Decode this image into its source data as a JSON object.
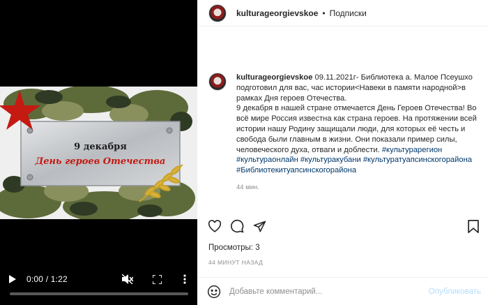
{
  "video": {
    "slide_date": "9 декабря",
    "slide_title": "День героев Отечества",
    "time": "0:00 / 1:22",
    "progress_fraction": 0.0
  },
  "post": {
    "username": "kulturageorgievskoe",
    "separator": "•",
    "follow": "Подписки"
  },
  "caption": {
    "username": "kulturageorgievskoe",
    "line1": " 09.11.2021г- Библиотека а. Малое Псеушхо подготовил для вас, час истории<Навеки в памяти народной>в рамках Дня героев Отечества.",
    "line2": "9 декабря в нашей стране отмечается День Героев Отечества! Во всё мире Россия известна как страна героев. На протяжении всей истории нашу Родину защищали люди, для которых её честь и свобода были главным в жизни. Они показали пример силы, человеческого духа, отваги и доблести. ",
    "hashtags": [
      "#культурарегион",
      "#культураонлайн",
      "#культуракубани",
      "#культуратуапсинскогорайона",
      "#Библиотекитуапсинскогорайона"
    ],
    "time": "44 мин."
  },
  "stats": {
    "views_label": "Просмотры:",
    "views_count": "3",
    "posted_ago": "44 МИНУТ НАЗАД"
  },
  "comment": {
    "placeholder": "Добавьте комментарий...",
    "publish": "Опубликовать"
  },
  "icons": [
    "play-icon",
    "mute-icon",
    "fullscreen-icon",
    "more-vertical-icon",
    "heart-icon",
    "comment-icon",
    "share-icon",
    "bookmark-icon",
    "emoji-icon"
  ],
  "colors": {
    "hashtag": "#00376b",
    "publish_disabled": "#b2dffc",
    "slide_red": "#c41a12"
  }
}
